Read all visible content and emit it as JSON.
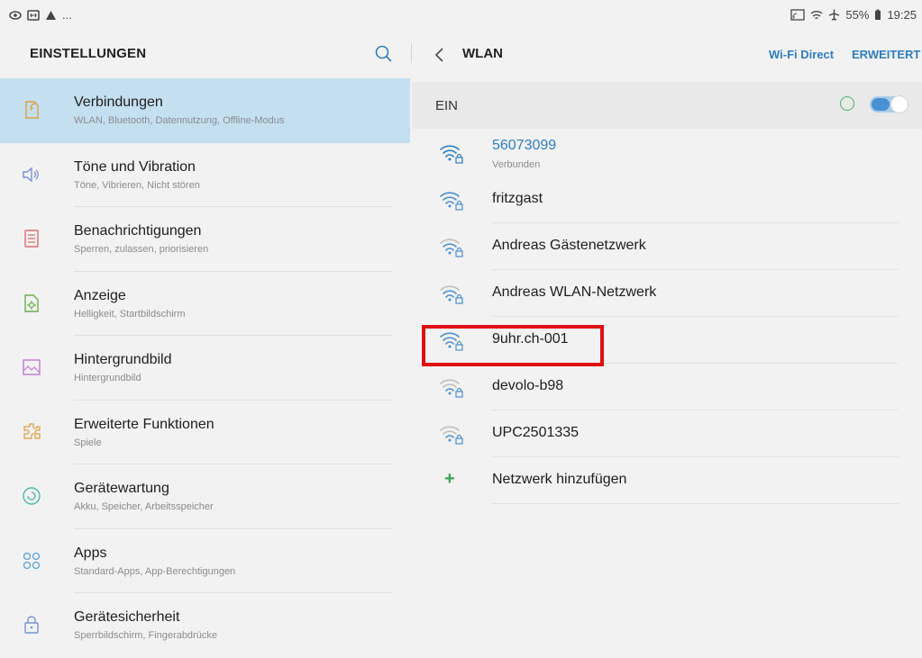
{
  "status_bar": {
    "left_icons": [
      "eye-icon",
      "screen-icon",
      "warning-icon",
      "more-dots"
    ],
    "left_more": "...",
    "right_text": "55%",
    "time": "19:25",
    "right_icons": [
      "cast-icon",
      "wifi-icon",
      "airplane-icon",
      "battery-icon"
    ]
  },
  "left_pane": {
    "title": "EINSTELLUNGEN",
    "items": [
      {
        "title": "Verbindungen",
        "subtitle": "WLAN, Bluetooth, Datennutzung, Offline-Modus",
        "icon": "connections-icon",
        "active": true
      },
      {
        "title": "Töne und Vibration",
        "subtitle": "Töne, Vibrieren, Nicht stören",
        "icon": "speaker-icon"
      },
      {
        "title": "Benachrichtigungen",
        "subtitle": "Sperren, zulassen, priorisieren",
        "icon": "notification-icon"
      },
      {
        "title": "Anzeige",
        "subtitle": "Helligkeit, Startbildschirm",
        "icon": "display-icon"
      },
      {
        "title": "Hintergrundbild",
        "subtitle": "Hintergrundbild",
        "icon": "wallpaper-icon"
      },
      {
        "title": "Erweiterte Funktionen",
        "subtitle": "Spiele",
        "icon": "puzzle-icon"
      },
      {
        "title": "Gerätewartung",
        "subtitle": "Akku, Speicher, Arbeitsspeicher",
        "icon": "maintenance-icon"
      },
      {
        "title": "Apps",
        "subtitle": "Standard-Apps, App-Berechtigungen",
        "icon": "apps-icon"
      },
      {
        "title": "Gerätesicherheit",
        "subtitle": "Sperrbildschirm, Fingerabdrücke",
        "icon": "lock-icon"
      }
    ]
  },
  "right_pane": {
    "title": "WLAN",
    "wifi_direct": "Wi-Fi Direct",
    "advanced": "ERWEITERT",
    "switch_label": "EIN",
    "switch_on": true,
    "networks": [
      {
        "name": "56073099",
        "status": "Verbunden",
        "connected": true
      },
      {
        "name": "fritzgast"
      },
      {
        "name": "Andreas Gästenetzwerk"
      },
      {
        "name": "Andreas WLAN-Netzwerk"
      },
      {
        "name": "9uhr.ch-001"
      },
      {
        "name": "devolo-b98"
      },
      {
        "name": "UPC2501335"
      }
    ],
    "add_network": "Netzwerk hinzufügen"
  },
  "colors": {
    "accent": "#2e7dc4",
    "active_bg": "#c4dff0",
    "icon_orange": "#e0a040",
    "highlight": "#e01010"
  }
}
